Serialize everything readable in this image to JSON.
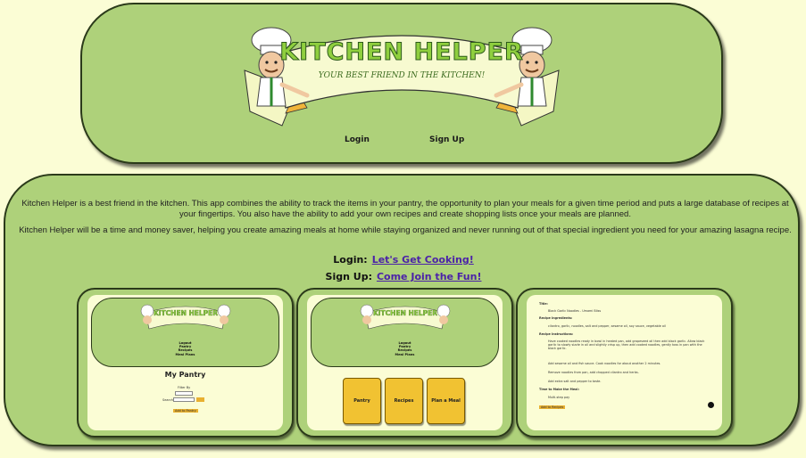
{
  "header": {
    "logo_title": "KITCHEN HELPER",
    "logo_subtitle": "YOUR BEST FRIEND IN THE KITCHEN!",
    "nav": {
      "login": "Login",
      "signup": "Sign Up"
    }
  },
  "main": {
    "paragraph_1": "Kitchen Helper is a best friend in the kitchen. This app combines the ability to track the items in your pantry, the opportunity to plan your meals for a given time period and puts a large database of recipes at your fingertips. You also have the ability to add your own recipes and create shopping lists once your meals are planned.",
    "paragraph_2": "Kitchen Helper will be a time and money saver, helping you create amazing meals at home while staying organized and never running out of that special ingredient you need for your amazing lasagna recipe.",
    "login_label": "Login:",
    "login_link": "Let's Get Cooking!",
    "signup_label": "Sign Up:",
    "signup_link": "Come Join the Fun!"
  },
  "previews": {
    "nav_items": [
      "Logout",
      "Pantry",
      "Recipes",
      "Meal Plans"
    ],
    "pantry": {
      "title": "My Pantry",
      "filter_label": "Filter By",
      "search_label": "Search",
      "button": "Add to Pantry"
    },
    "tiles": [
      "Pantry",
      "Recipes",
      "Plan a Meal"
    ],
    "recipe": {
      "title_label": "Title:",
      "title": "Black Garlic Noodles - Umami Bliss",
      "ingredients_label": "Recipe Ingredients:",
      "ingredients": "cilantro, garlic, noodles, salt and pepper, sesame oil, soy sauce, vegetable oil",
      "instructions_label": "Recipe Instructions:",
      "steps": [
        "Have cooked noodles ready in bowl in heated pan, add grapeseed oil then add black garlic. Allow black garlic to slowly sizzle in oil and slightly crisp up, then add cooked noodles, gently toss in pan with the black garlic.",
        "Add sesame oil and fish sauce. Cook noodles for about another 2 minutes.",
        "Remove noodles from pan, add chopped cilantro and herbs.",
        "Add extra salt and pepper to taste."
      ],
      "add_label": "Time to Make the Meal:",
      "add_value": "Multi-step pay",
      "button": "Add to Recipes"
    }
  },
  "colors": {
    "panel": "#aed17a",
    "background": "#fbfdd5",
    "link": "#4b22a8",
    "tile": "#f1c232"
  }
}
